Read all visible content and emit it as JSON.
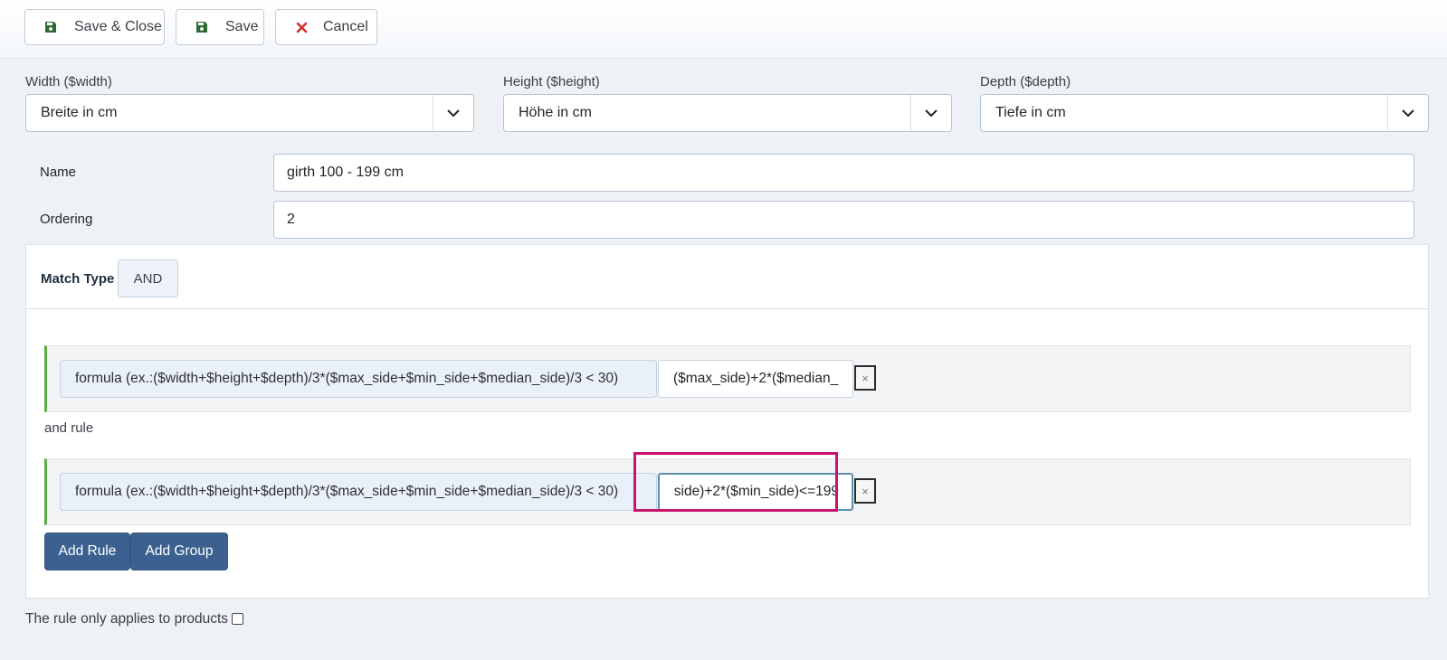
{
  "toolbar": {
    "save_close": "Save & Close",
    "save": "Save",
    "cancel": "Cancel"
  },
  "dimensions": {
    "width": {
      "label": "Width ($width)",
      "value": "Breite in cm"
    },
    "height": {
      "label": "Height ($height)",
      "value": "Höhe in cm"
    },
    "depth": {
      "label": "Depth ($depth)",
      "value": "Tiefe in cm"
    }
  },
  "form": {
    "name_label": "Name",
    "name_value": "girth 100 - 199 cm",
    "ordering_label": "Ordering",
    "ordering_value": "2"
  },
  "rules": {
    "match_type_label": "Match Type",
    "match_type_value": "AND",
    "items": [
      {
        "field": "formula (ex.:($width+$height+$depth)/3*($max_side+$min_side+$median_side)/3 < 30)",
        "value": "($max_side)+2*($median_"
      },
      {
        "field": "formula (ex.:($width+$height+$depth)/3*($max_side+$min_side+$median_side)/3 < 30)",
        "value": "side)+2*($min_side)<=199"
      }
    ],
    "joiner": "and rule",
    "delete_symbol": "×",
    "add_rule": "Add Rule",
    "add_group": "Add Group"
  },
  "footer": {
    "products_only_label": "The rule only applies to products",
    "products_only_checked": false
  },
  "colors": {
    "primary_button": "#3c6190",
    "rule_accent": "#5cae43",
    "highlight": "#c8146e",
    "save_icon": "#2e7d32",
    "cancel_icon": "#d32f2f"
  }
}
